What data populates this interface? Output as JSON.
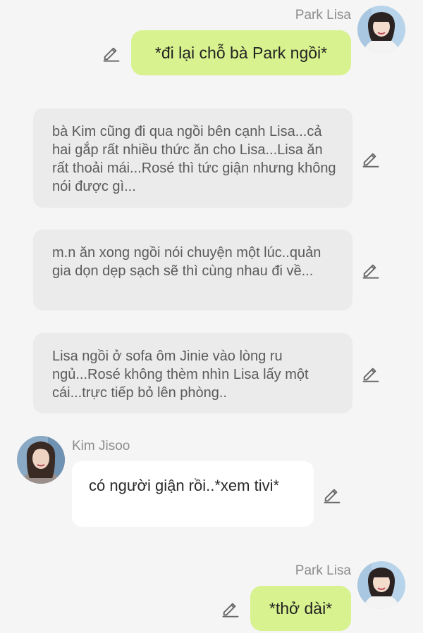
{
  "messages": [
    {
      "sender": "Park Lisa",
      "text": "*đi lại chỗ bà Park ngồi*"
    },
    {
      "text": "bà Kim cũng đi qua ngồi bên cạnh Lisa...cả hai gắp rất nhiều thức ăn cho Lisa...Lisa ăn rất thoải mái...Rosé thì tức giận nhưng không nói được gì..."
    },
    {
      "text": "m.n ăn xong ngồi nói chuyện một lúc..quản gia dọn dẹp sạch sẽ thì cùng nhau đi về..."
    },
    {
      "text": "Lisa ngồi ở sofa ôm Jinie vào lòng ru ngủ...Rosé không thèm nhìn Lisa lấy một cái...trực tiếp bỏ lên phòng.."
    },
    {
      "sender": "Kim Jisoo",
      "text": "có người giận rồi..*xem tivi*"
    },
    {
      "sender": "Park Lisa",
      "text": "*thở dài*"
    }
  ],
  "icons": {
    "edit": "pencil-icon"
  },
  "colors": {
    "background": "#f5f5f5",
    "my_bubble": "#d7f28e",
    "narration_bubble": "#ebebeb",
    "other_bubble": "#ffffff",
    "name_text": "#8c8c8c"
  }
}
